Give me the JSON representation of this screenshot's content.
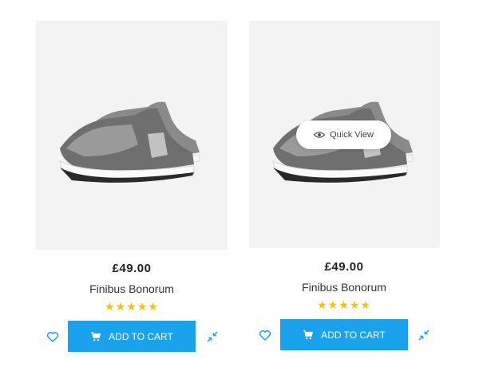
{
  "products": [
    {
      "price": "£49.00",
      "name": "Finibus Bonorum",
      "rating_stars": "★★★★★",
      "rating": 5,
      "add_to_cart_label": "ADD TO CART"
    },
    {
      "price": "£49.00",
      "name": "Finibus Bonorum",
      "rating_stars": "★★★★★",
      "rating": 5,
      "add_to_cart_label": "ADD TO CART",
      "quick_view_label": "Quick View"
    }
  ],
  "colors": {
    "accent": "#1aa3ec",
    "stars": "#f5c200",
    "image_bg": "#f3f3f3"
  },
  "icons": [
    "heart-icon",
    "cart-icon",
    "compare-icon",
    "eye-icon"
  ]
}
